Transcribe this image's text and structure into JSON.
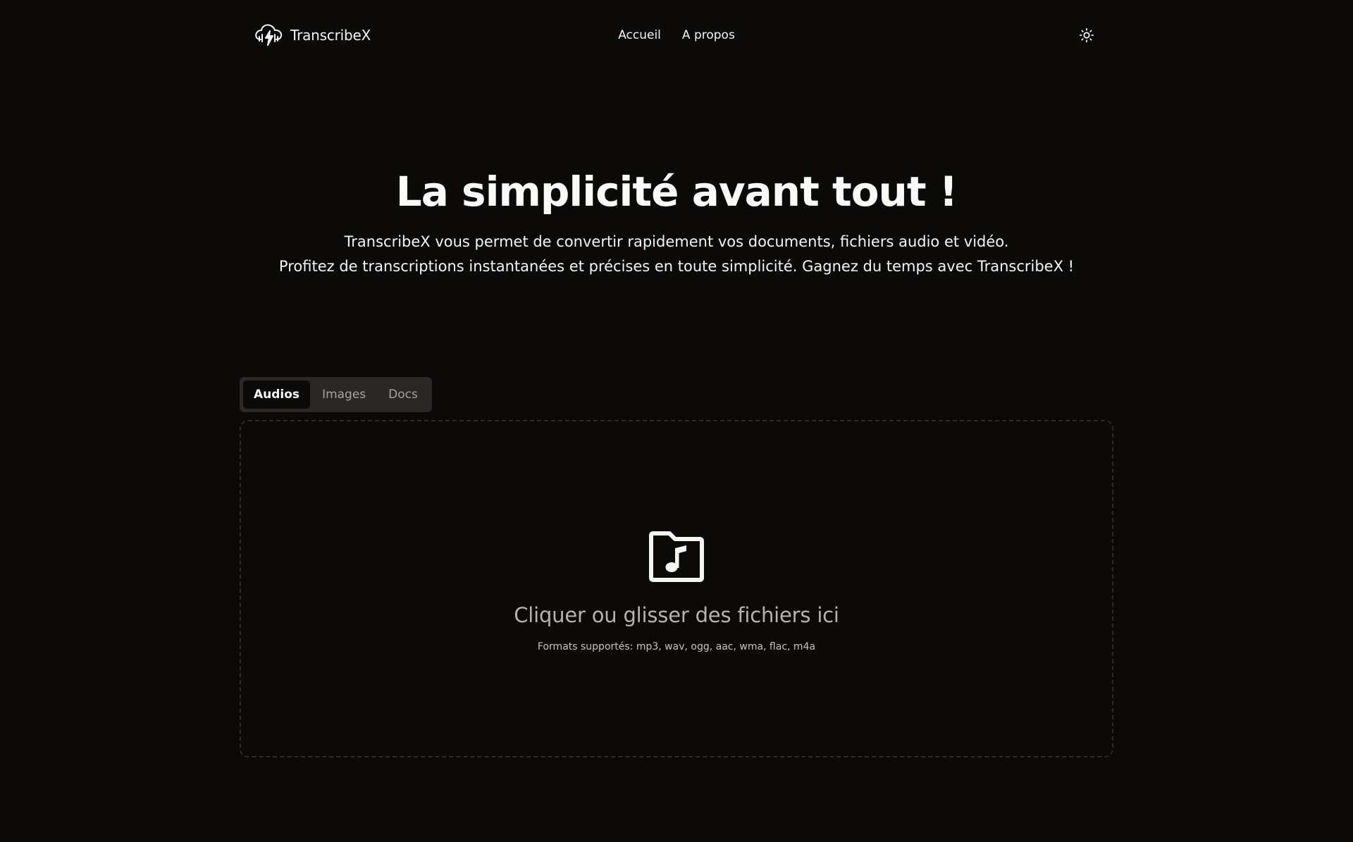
{
  "header": {
    "brand_name": "TranscribeX",
    "nav": [
      {
        "label": "Accueil"
      },
      {
        "label": "A propos"
      }
    ],
    "theme_icon": "sun-icon"
  },
  "hero": {
    "title": "La simplicité avant tout !",
    "subtitle_line1": "TranscribeX vous permet de convertir rapidement vos documents, fichiers audio et vidéo.",
    "subtitle_line2": "Profitez de transcriptions instantanées et précises en toute simplicité. Gagnez du temps avec TranscribeX !"
  },
  "tabs": [
    {
      "label": "Audios",
      "active": true
    },
    {
      "label": "Images",
      "active": false
    },
    {
      "label": "Docs",
      "active": false
    }
  ],
  "dropzone": {
    "icon": "music-folder-icon",
    "title": "Cliquer ou glisser des fichiers ici",
    "formats": "Formats supportés: mp3, wav, ogg, aac, wma, flac, m4a"
  },
  "colors": {
    "background": "#0b0a09",
    "tabs_bg": "#2a2826",
    "muted_text": "#a8a29e",
    "border": "#2e2c2a"
  }
}
